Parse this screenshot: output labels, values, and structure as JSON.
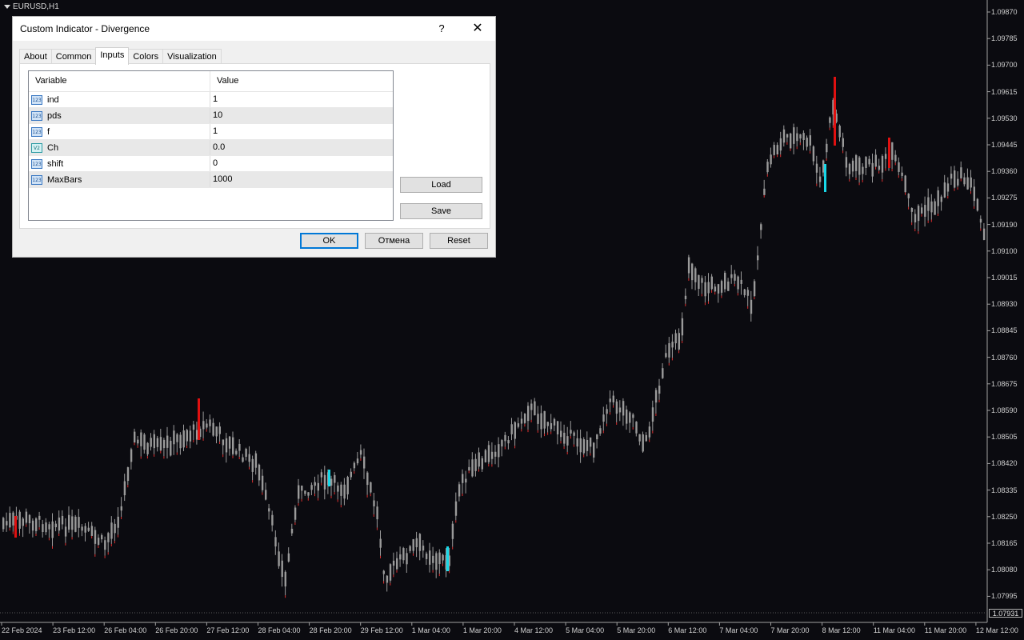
{
  "symbol_label": "EURUSD,H1",
  "dialog": {
    "title": "Custom Indicator - Divergence",
    "help_label": "?",
    "close_label": "✕",
    "tabs": [
      "About",
      "Common",
      "Inputs",
      "Colors",
      "Visualization"
    ],
    "active_tab": "Inputs",
    "grid_headers": {
      "variable": "Variable",
      "value": "Value"
    },
    "inputs": [
      {
        "icon": "123",
        "name": "ind",
        "value": "1"
      },
      {
        "icon": "123",
        "name": "pds",
        "value": "10"
      },
      {
        "icon": "123",
        "name": "f",
        "value": "1"
      },
      {
        "icon": "V2",
        "name": "Ch",
        "value": "0.0"
      },
      {
        "icon": "123",
        "name": "shift",
        "value": "0"
      },
      {
        "icon": "123",
        "name": "MaxBars",
        "value": "1000"
      }
    ],
    "load_label": "Load",
    "save_label": "Save",
    "ok_label": "OK",
    "cancel_label": "Отмена",
    "reset_label": "Reset"
  },
  "price_axis": [
    "1.09870",
    "1.09785",
    "1.09700",
    "1.09615",
    "1.09530",
    "1.09445",
    "1.09360",
    "1.09275",
    "1.09190",
    "1.09100",
    "1.09015",
    "1.08930",
    "1.08845",
    "1.08760",
    "1.08675",
    "1.08590",
    "1.08505",
    "1.08420",
    "1.08335",
    "1.08250",
    "1.08165",
    "1.08080",
    "1.07995"
  ],
  "current_price": "1.07931",
  "time_axis": [
    "22 Feb 2024",
    "23 Feb 12:00",
    "26 Feb 04:00",
    "26 Feb 20:00",
    "27 Feb 12:00",
    "28 Feb 04:00",
    "28 Feb 20:00",
    "29 Feb 12:00",
    "1 Mar 04:00",
    "1 Mar 20:00",
    "4 Mar 12:00",
    "5 Mar 04:00",
    "5 Mar 20:00",
    "6 Mar 12:00",
    "7 Mar 04:00",
    "7 Mar 20:00",
    "8 Mar 12:00",
    "11 Mar 04:00",
    "11 Mar 20:00",
    "12 Mar 12:00"
  ],
  "colors": {
    "background": "#0b0b10",
    "candle": "#9a9a9a",
    "bearish_signal": "#e01010",
    "bullish_signal": "#18d8e8",
    "wick_low": "#e03030"
  }
}
